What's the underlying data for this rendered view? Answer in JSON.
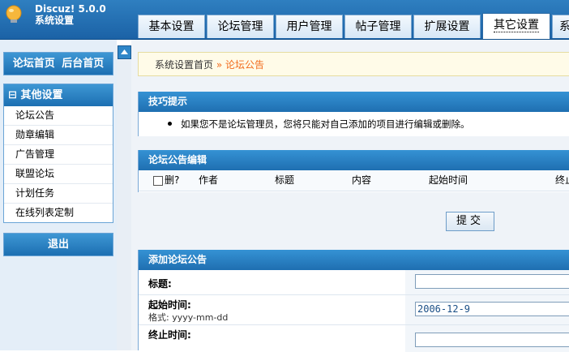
{
  "header": {
    "brand_line1": "Discuz! 5.0.0",
    "brand_line2": "系统设置",
    "tabs": [
      {
        "label": "基本设置"
      },
      {
        "label": "论坛管理"
      },
      {
        "label": "用户管理"
      },
      {
        "label": "帖子管理"
      },
      {
        "label": "扩展设置"
      },
      {
        "label": "其它设置",
        "active": true
      },
      {
        "label": "系"
      }
    ]
  },
  "sidebar": {
    "top_links": {
      "home": "论坛首页",
      "admin": "后台首页"
    },
    "section_title": "其他设置",
    "section_toggle": "⊟",
    "items": [
      "论坛公告",
      "勋章编辑",
      "广告管理",
      "联盟论坛",
      "计划任务",
      "在线列表定制"
    ],
    "logout": "退出"
  },
  "breadcrumb": {
    "home": "系统设置首页",
    "separator": "»",
    "current": "论坛公告"
  },
  "tips": {
    "title": "技巧提示",
    "text": "如果您不是论坛管理员，您将只能对自己添加的项目进行编辑或删除。"
  },
  "edit_panel": {
    "title": "论坛公告编辑",
    "columns": {
      "delete": "删?",
      "author": "作者",
      "subject": "标题",
      "content": "内容",
      "start": "起始时间",
      "end": "终止"
    }
  },
  "submit_label": "提交",
  "add_panel": {
    "title": "添加论坛公告",
    "subject_label": "标题:",
    "start_label": "起始时间:",
    "start_hint": "格式: yyyy-mm-dd",
    "start_value": "2006-12-9",
    "end_label": "终止时间:"
  },
  "colors": {
    "accent": "#1f6fb1",
    "crumb_current": "#f26b1c"
  }
}
